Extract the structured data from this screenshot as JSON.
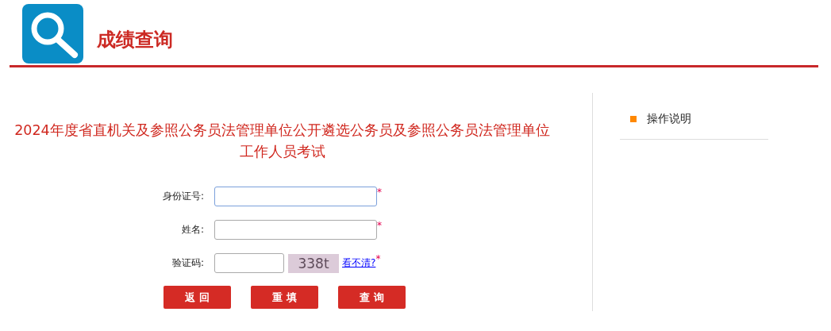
{
  "header": {
    "title": "成绩查询"
  },
  "exam_title": "2024年度省直机关及参照公务员法管理单位公开遴选公务员及参照公务员法管理单位工作人员考试",
  "form": {
    "fields": [
      {
        "kind": "text",
        "label": "身份证号:",
        "focused": true,
        "required_mark": "*"
      },
      {
        "kind": "text",
        "label": "姓名:",
        "focused": false,
        "required_mark": "*"
      },
      {
        "kind": "captcha",
        "label": "验证码:",
        "focused": false,
        "captcha_text": "338t",
        "refresh_link": "看不清?",
        "required_mark": "*"
      }
    ]
  },
  "buttons": [
    "返 回",
    "重 填",
    "查 询"
  ],
  "sidebar": {
    "items": [
      "操作说明"
    ]
  }
}
